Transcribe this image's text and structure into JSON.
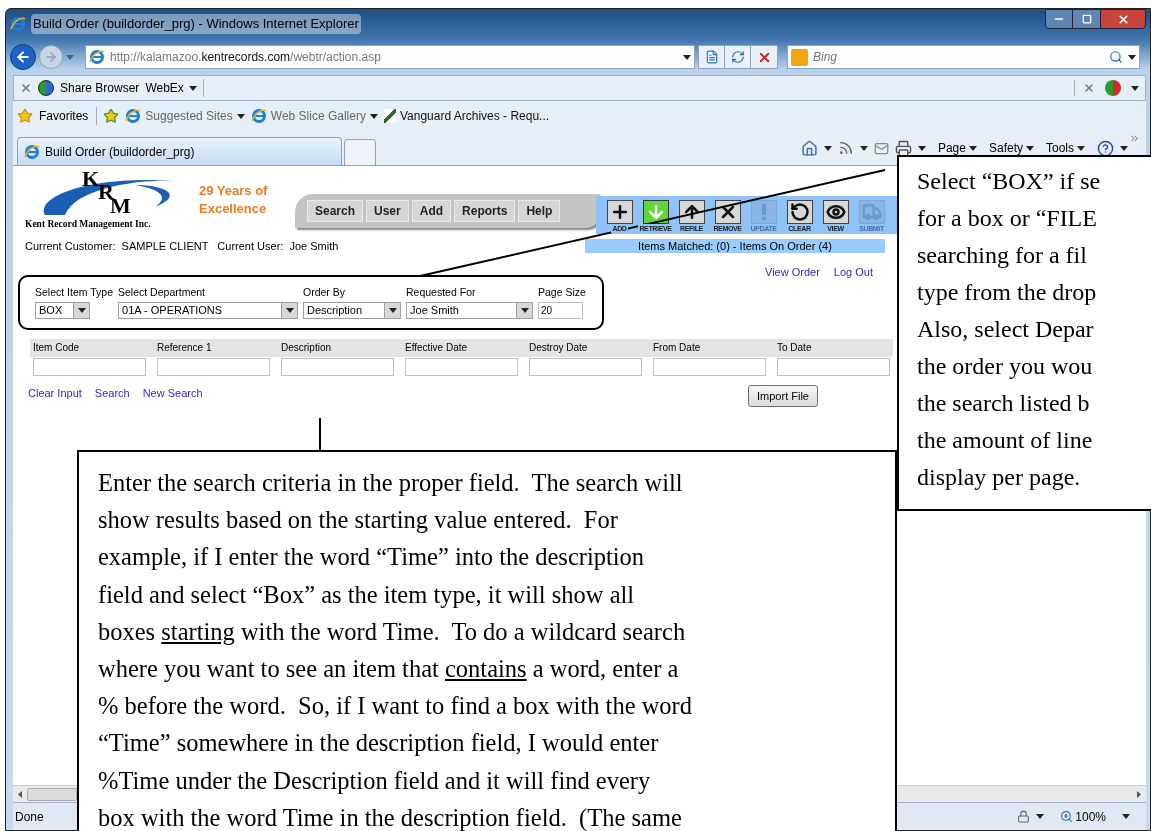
{
  "window": {
    "title": "Build Order (buildorder_prg) - Windows Internet Explorer"
  },
  "address_bar": {
    "url": [
      {
        "text": "http://kalamazoo.",
        "emphasis": false
      },
      {
        "text": "kentrecords.com",
        "emphasis": true
      },
      {
        "text": "/webtr/action.asp",
        "emphasis": false
      }
    ]
  },
  "search_box": {
    "placeholder": "Bing"
  },
  "command_bar": {
    "share": "Share Browser",
    "webex": "WebEx"
  },
  "favorites_bar": {
    "favorites": "Favorites",
    "links": [
      {
        "label": "Suggested Sites",
        "kind": "menu"
      },
      {
        "label": "Web Slice Gallery",
        "kind": "menu"
      },
      {
        "label": "Vanguard Archives - Requ...",
        "kind": "link"
      }
    ]
  },
  "tabs": [
    {
      "label": "Build Order (buildorder_prg)",
      "selected": true
    }
  ],
  "tab_menus": [
    "Page",
    "Safety",
    "Tools"
  ],
  "app": {
    "logo_letters": [
      "K",
      "R",
      "M"
    ],
    "logo_company": "Kent Record Management Inc.",
    "tagline": [
      "29 Years of",
      "Excellence"
    ],
    "nav": [
      "Search",
      "User",
      "Add",
      "Reports",
      "Help"
    ],
    "toolbar": [
      {
        "label": "ADD",
        "kind": "plus",
        "disabled": false,
        "active": false
      },
      {
        "label": "RETRIEVE",
        "kind": "down",
        "disabled": false,
        "active": true
      },
      {
        "label": "REFILE",
        "kind": "up",
        "disabled": false,
        "active": false
      },
      {
        "label": "REMOVE",
        "kind": "x",
        "disabled": false,
        "active": false
      },
      {
        "label": "UPDATE",
        "kind": "alert",
        "disabled": true,
        "active": false
      },
      {
        "label": "CLEAR",
        "kind": "clear",
        "disabled": false,
        "active": false
      },
      {
        "label": "VIEW",
        "kind": "eye",
        "disabled": false,
        "active": false
      },
      {
        "label": "SUBMIT",
        "kind": "truck",
        "disabled": true,
        "active": false
      }
    ],
    "customer_label": "Current Customer:",
    "customer": "SAMPLE CLIENT",
    "user_label": "Current User:",
    "user": "Joe Smith",
    "items_status": "Items Matched: (0) - Items On Order (4)",
    "links": [
      "View Order",
      "Log Out"
    ],
    "options": [
      {
        "label": "Select Item Type",
        "kind": "select",
        "value": "BOX"
      },
      {
        "label": "Select Department",
        "kind": "select",
        "value": "01A - OPERATIONS"
      },
      {
        "label": "Order By",
        "kind": "select",
        "value": "Description"
      },
      {
        "label": "Requested For",
        "kind": "select",
        "value": "Joe Smith"
      },
      {
        "label": "Page Size",
        "kind": "input",
        "value": "20"
      }
    ],
    "criteria": [
      {
        "label": "Item Code"
      },
      {
        "label": "Reference 1"
      },
      {
        "label": "Description"
      },
      {
        "label": "Effective Date"
      },
      {
        "label": "Destroy Date"
      },
      {
        "label": "From Date"
      },
      {
        "label": "To Date"
      }
    ],
    "actions": [
      "Clear Input",
      "Search",
      "New Search"
    ],
    "import_button": "Import File"
  },
  "callouts": {
    "right": {
      "lines": [
        "Select “BOX” if se",
        "for a box or “FILE",
        "searching for a fil",
        "type from the drop",
        "Also, select Depar",
        "the order you wou",
        "the search listed b",
        "the amount of line",
        "display per page."
      ]
    },
    "bottom": {
      "lines": [
        [
          {
            "text": "Enter the search criteria in the proper field.  The search will",
            "underline": false
          }
        ],
        [
          {
            "text": "show results based on the starting value entered.  For",
            "underline": false
          }
        ],
        [
          {
            "text": "example, if I enter the word “Time” into the description",
            "underline": false
          }
        ],
        [
          {
            "text": "field and select “Box” as the item type, it will show all",
            "underline": false
          }
        ],
        [
          {
            "text": "boxes ",
            "underline": false
          },
          {
            "text": "starting",
            "underline": true
          },
          {
            "text": " with the word Time.  To do a wildcard search",
            "underline": false
          }
        ],
        [
          {
            "text": "where you want to see an item that ",
            "underline": false
          },
          {
            "text": "contains",
            "underline": true
          },
          {
            "text": " a word, enter a",
            "underline": false
          }
        ],
        [
          {
            "text": "% before the word.  So, if I want to find a box with the word",
            "underline": false
          }
        ],
        [
          {
            "text": "“Time” somewhere in the description field, I would enter",
            "underline": false
          }
        ],
        [
          {
            "text": "%Time under the Description field and it will find every",
            "underline": false
          }
        ],
        [
          {
            "text": "box with the word Time in the description field.  (The same",
            "underline": false
          }
        ]
      ]
    }
  },
  "status_bar": {
    "text": "Done",
    "zoom": "100%"
  }
}
